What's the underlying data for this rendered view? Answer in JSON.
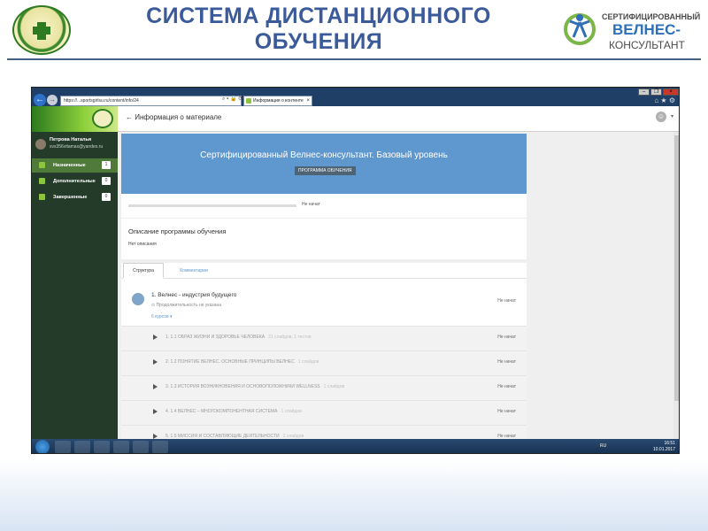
{
  "slide": {
    "title_line1": "СИСТЕМА ДИСТАНЦИОННОГО",
    "title_line2": "ОБУЧЕНИЯ",
    "logo_right": {
      "line1": "СЕРТИФИЦИРОВАННЫЙ",
      "line2": "ВЕЛНЕС-",
      "line3": "КОНСУЛЬТАНТ"
    }
  },
  "browser": {
    "url": "https://...sportsgirlsu.ru/content/info/24",
    "tab_label": "Информация о контенте",
    "tab_close": "×",
    "nav_back_icon": "←",
    "nav_fwd_icon": "→",
    "address_icons": "⌕ ▾ 🔒 ⟳ ×",
    "toolbar_icons": "⌂ ★ ⚙",
    "window_buttons": [
      "–",
      "❐",
      "×"
    ]
  },
  "app": {
    "page_header": "← Информация о материале",
    "user_menu_caret": "▾",
    "user": {
      "name": "Петрова Наталья",
      "email": "svs356vitamax@yandex.ru"
    },
    "sidebar": [
      {
        "label": "Назначенные",
        "count": "1",
        "active": true
      },
      {
        "label": "Дополнительные",
        "count": "0",
        "active": false
      },
      {
        "label": "Завершенные",
        "count": "0",
        "active": false
      }
    ],
    "hero": {
      "title": "Сертифицированный Велнес-консультант. Базовый уровень",
      "badge": "ПРОГРАММА ОБУЧЕНИЯ"
    },
    "progress": {
      "status": "Не начат",
      "fraction": 0
    },
    "description": {
      "heading": "Описание программы обучения",
      "body": "Нет описания"
    },
    "tabs": [
      "Структура",
      "Комментарии"
    ],
    "module": {
      "title": "1. Велнес - индустрия будущего",
      "duration": "⊙ Продолжительность не указана",
      "courses_link": "6 курсов ▾",
      "status": "Не начат"
    },
    "courses": [
      {
        "title": "1. 1.1 ОБРАЗ ЖИЗНИ И ЗДОРОВЬЕ ЧЕЛОВЕКА",
        "meta": "21 слайдов, 1 тестов",
        "status": "Не начат"
      },
      {
        "title": "2. 1.2 ПОНЯТИЕ ВЕЛНЕС. ОСНОВНЫЕ ПРИНЦИПЫ ВЕЛНЕС",
        "meta": "1 слайдов",
        "status": "Не начат"
      },
      {
        "title": "3. 1.3 ИСТОРИЯ ВОЗНИКНОВЕНИЯ И ОСНОВОПОЛОЖНИКИ WELLNESS",
        "meta": "1 слайдов",
        "status": "Не начат"
      },
      {
        "title": "4. 1.4 ВЕЛНЕС – МНОГОКОМПОНЕНТНАЯ СИСТЕМА",
        "meta": "1 слайдов",
        "status": "Не начат"
      },
      {
        "title": "5. 1.5 МИССИЯ И СОСТАВЛЯЮЩИЕ ДЕЯТЕЛЬНОСТИ",
        "meta": "1 слайдов",
        "status": "Не начат"
      }
    ]
  },
  "taskbar": {
    "lang": "RU",
    "time": "16:51",
    "date": "10.01.2017"
  },
  "colors": {
    "title": "#3a5a9a",
    "hero": "#5f97cf",
    "sidebar": "#243b2a",
    "accent_green": "#8cc63f"
  }
}
